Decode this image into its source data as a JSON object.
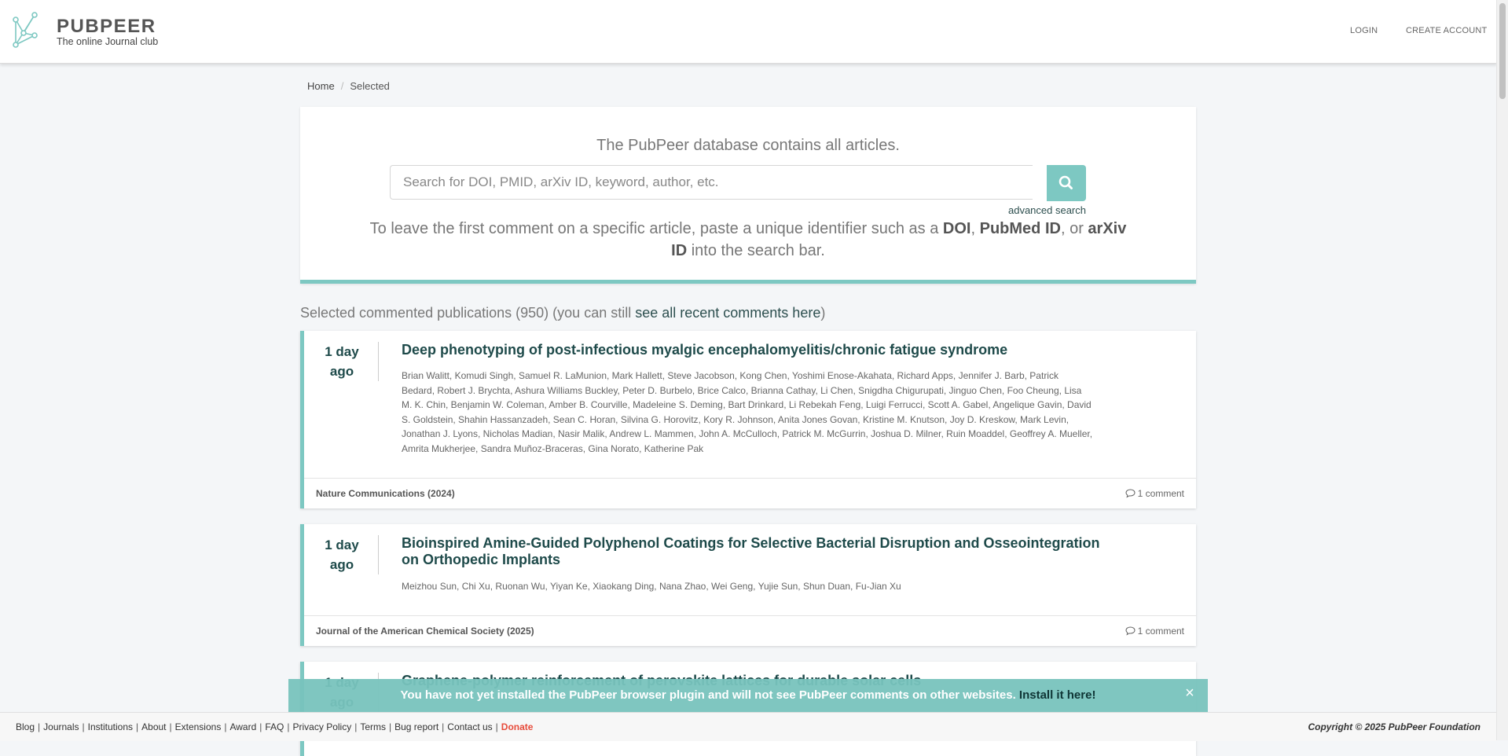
{
  "header": {
    "brand_name": "PUBPEER",
    "brand_tagline": "The online Journal club",
    "nav": {
      "login": "LOGIN",
      "create_account": "CREATE ACCOUNT"
    }
  },
  "breadcrumb": {
    "home": "Home",
    "separator": "/",
    "current": "Selected"
  },
  "search": {
    "heading": "The PubPeer database contains all articles.",
    "placeholder": "Search for DOI, PMID, arXiv ID, keyword, author, etc.",
    "value": "",
    "advanced_label": "advanced search",
    "help_part1": "To leave the first comment on a specific article, paste a unique identifier such as a ",
    "help_doi": "DOI",
    "help_comma": ", ",
    "help_pubmed": "PubMed ID",
    "help_or": ", or ",
    "help_arxiv": "arXiv ID",
    "help_part2": " into the search bar."
  },
  "section": {
    "heading_prefix": "Selected commented publications (950) (you can still ",
    "link_label": "see all recent comments here",
    "heading_suffix": ")"
  },
  "publications": [
    {
      "time_line1": "1 day",
      "time_line2": "ago",
      "title": "Deep phenotyping of post-infectious myalgic encephalomyelitis/chronic fatigue syndrome",
      "authors": "Brian Walitt, Komudi Singh, Samuel R. LaMunion, Mark Hallett, Steve Jacobson, Kong Chen, Yoshimi Enose-Akahata, Richard Apps, Jennifer J. Barb, Patrick Bedard, Robert J. Brychta, Ashura Williams Buckley, Peter D. Burbelo, Brice Calco, Brianna Cathay, Li Chen, Snigdha Chigurupati, Jinguo Chen, Foo Cheung, Lisa M. K. Chin, Benjamin W. Coleman, Amber B. Courville, Madeleine S. Deming, Bart Drinkard, Li Rebekah Feng, Luigi Ferrucci, Scott A. Gabel, Angelique Gavin, David S. Goldstein, Shahin Hassanzadeh, Sean C. Horan, Silvina G. Horovitz, Kory R. Johnson, Anita Jones Govan, Kristine M. Knutson, Joy D. Kreskow, Mark Levin, Jonathan J. Lyons, Nicholas Madian, Nasir Malik, Andrew L. Mammen, John A. McCulloch, Patrick M. McGurrin, Joshua D. Milner, Ruin Moaddel, Geoffrey A. Mueller, Amrita Mukherjee, Sandra Muñoz-Braceras, Gina Norato, Katherine Pak",
      "journal": "Nature Communications (2024)",
      "comments": "1 comment"
    },
    {
      "time_line1": "1 day",
      "time_line2": "ago",
      "title": "Bioinspired Amine-Guided Polyphenol Coatings for Selective Bacterial Disruption and Osseointegration on Orthopedic Implants",
      "authors": "Meizhou Sun, Chi Xu, Ruonan Wu, Yiyan Ke, Xiaokang Ding, Nana Zhao, Wei Geng, Yujie Sun, Shun Duan, Fu-Jian Xu",
      "journal": "Journal of the American Chemical Society (2025)",
      "comments": "1 comment"
    },
    {
      "time_line1": "1 day",
      "time_line2": "ago",
      "title": "Graphene-polymer reinforcement of perovskite lattices for durable solar cells"
    }
  ],
  "plugin_banner": {
    "message": "You have not yet installed the PubPeer browser plugin and will not see PubPeer comments on other websites. ",
    "link_label": "Install it here!",
    "close": "×"
  },
  "footer": {
    "links": [
      "Blog",
      "Journals",
      "Institutions",
      "About",
      "Extensions",
      "Award",
      "FAQ",
      "Privacy Policy",
      "Terms",
      "Bug report",
      "Contact us"
    ],
    "separator": "|",
    "donate": "Donate",
    "copyright": "Copyright © 2025 PubPeer Foundation"
  },
  "colors": {
    "accent": "#7dc8c2",
    "title": "#1e4a4a",
    "donate": "#e74c3c"
  },
  "icons": {
    "logo": "pubpeer-logo-icon",
    "search": "search-icon",
    "comment": "comment-icon",
    "close": "close-icon"
  }
}
